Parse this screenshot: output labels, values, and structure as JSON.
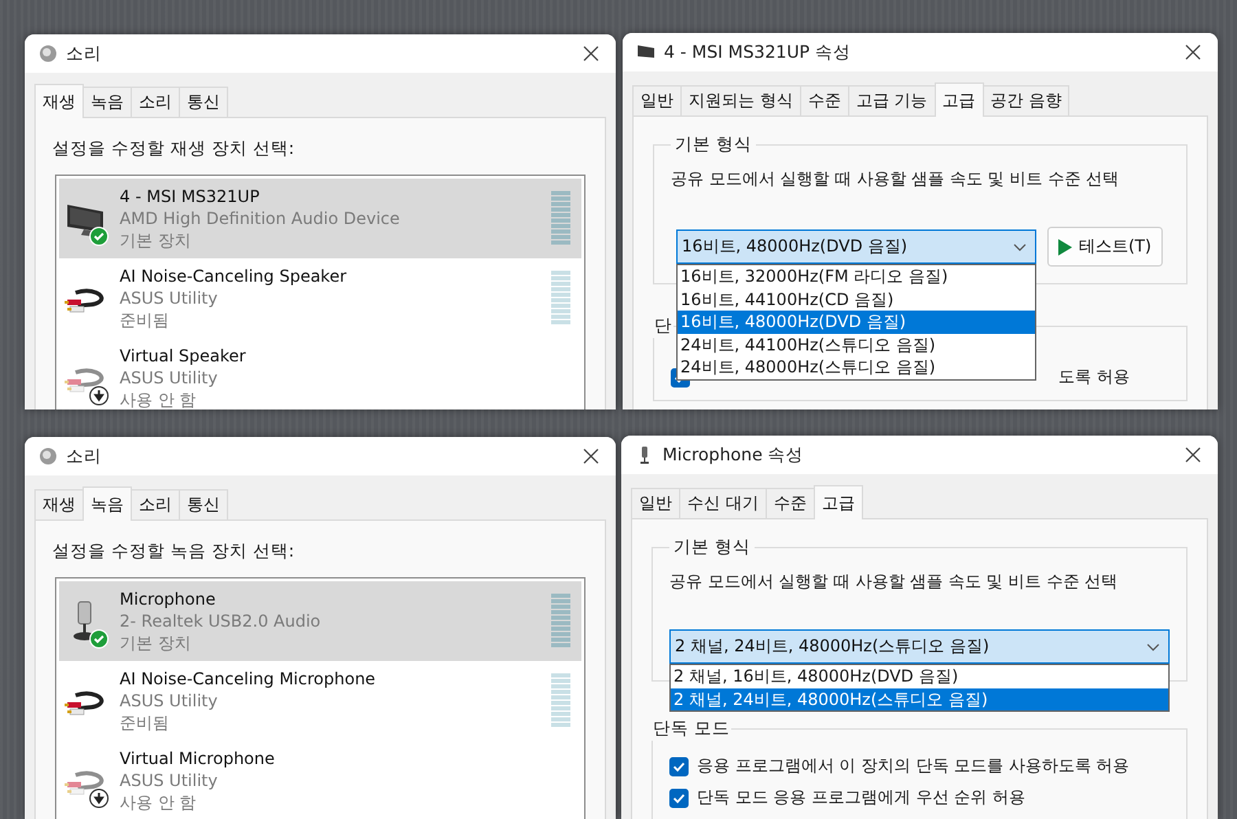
{
  "windows": [
    {
      "kind": "sound",
      "title": "소리",
      "tabs": [
        {
          "label": "재생",
          "selected": true
        },
        {
          "label": "녹음",
          "selected": false
        },
        {
          "label": "소리",
          "selected": false
        },
        {
          "label": "통신",
          "selected": false
        }
      ],
      "prompt": "설정을 수정할 재생 장치 선택:",
      "devices": [
        {
          "name": "4 - MSI MS321UP",
          "driver": "AMD High Definition Audio Device",
          "status": "기본 장치",
          "kind": "monitor",
          "default": true,
          "enabled": true,
          "selected": true
        },
        {
          "name": "AI Noise-Canceling Speaker",
          "driver": "ASUS Utility",
          "status": "준비됨",
          "kind": "cable",
          "default": false,
          "enabled": true,
          "selected": false
        },
        {
          "name": "Virtual Speaker",
          "driver": "ASUS Utility",
          "status": "사용 안 함",
          "kind": "cable",
          "default": false,
          "enabled": false,
          "selected": false
        }
      ]
    },
    {
      "kind": "playback-properties",
      "title": "4 - MSI MS321UP 속성",
      "tabs": [
        {
          "label": "일반",
          "selected": false
        },
        {
          "label": "지원되는 형식",
          "selected": false
        },
        {
          "label": "수준",
          "selected": false
        },
        {
          "label": "고급 기능",
          "selected": false
        },
        {
          "label": "고급",
          "selected": true
        },
        {
          "label": "공간 음향",
          "selected": false
        }
      ],
      "format_group": {
        "legend": "기본 형식",
        "description": "공유 모드에서 실행할 때 사용할 샘플 속도 및 비트 수준 선택",
        "dropdown": {
          "value": "16비트, 48000Hz(DVD 음질)",
          "expanded": true,
          "options": [
            {
              "label": "16비트, 32000Hz(FM 라디오 음질)",
              "selected": false
            },
            {
              "label": "16비트, 44100Hz(CD 음질)",
              "selected": false
            },
            {
              "label": "16비트, 48000Hz(DVD 음질)",
              "selected": true
            },
            {
              "label": "24비트, 44100Hz(스튜디오 음질)",
              "selected": false
            },
            {
              "label": "24비트, 48000Hz(스튜디오 음질)",
              "selected": false
            }
          ]
        },
        "test_button": "테스트(T)"
      },
      "exclusive_group": {
        "legend": "단",
        "options": [
          {
            "label": "도록 허용",
            "checked": true
          }
        ]
      }
    },
    {
      "kind": "sound",
      "title": "소리",
      "tabs": [
        {
          "label": "재생",
          "selected": false
        },
        {
          "label": "녹음",
          "selected": true
        },
        {
          "label": "소리",
          "selected": false
        },
        {
          "label": "통신",
          "selected": false
        }
      ],
      "prompt": "설정을 수정할 녹음 장치 선택:",
      "devices": [
        {
          "name": "Microphone",
          "driver": "2- Realtek USB2.0 Audio",
          "status": "기본 장치",
          "kind": "microphone",
          "default": true,
          "enabled": true,
          "selected": true
        },
        {
          "name": "AI Noise-Canceling Microphone",
          "driver": "ASUS Utility",
          "status": "준비됨",
          "kind": "cable",
          "default": false,
          "enabled": true,
          "selected": false
        },
        {
          "name": "Virtual Microphone",
          "driver": "ASUS Utility",
          "status": "사용 안 함",
          "kind": "cable",
          "default": false,
          "enabled": false,
          "selected": false
        }
      ]
    },
    {
      "kind": "recording-properties",
      "title": "Microphone 속성",
      "tabs": [
        {
          "label": "일반",
          "selected": false
        },
        {
          "label": "수신 대기",
          "selected": false
        },
        {
          "label": "수준",
          "selected": false
        },
        {
          "label": "고급",
          "selected": true
        }
      ],
      "format_group": {
        "legend": "기본 형식",
        "description": "공유 모드에서 실행할 때 사용할 샘플 속도 및 비트 수준 선택",
        "dropdown": {
          "value": "2 채널, 24비트, 48000Hz(스튜디오 음질)",
          "expanded": true,
          "options": [
            {
              "label": "2 채널, 16비트, 48000Hz(DVD 음질)",
              "selected": false
            },
            {
              "label": "2 채널, 24비트, 48000Hz(스튜디오 음질)",
              "selected": true
            }
          ]
        }
      },
      "exclusive_group": {
        "legend": "단독 모드",
        "options": [
          {
            "label": "응용 프로그램에서 이 장치의 단독 모드를 사용하도록 허용",
            "checked": true
          },
          {
            "label": "단독 모드 응용 프로그램에게 우선 순위 허용",
            "checked": true
          }
        ]
      }
    }
  ]
}
